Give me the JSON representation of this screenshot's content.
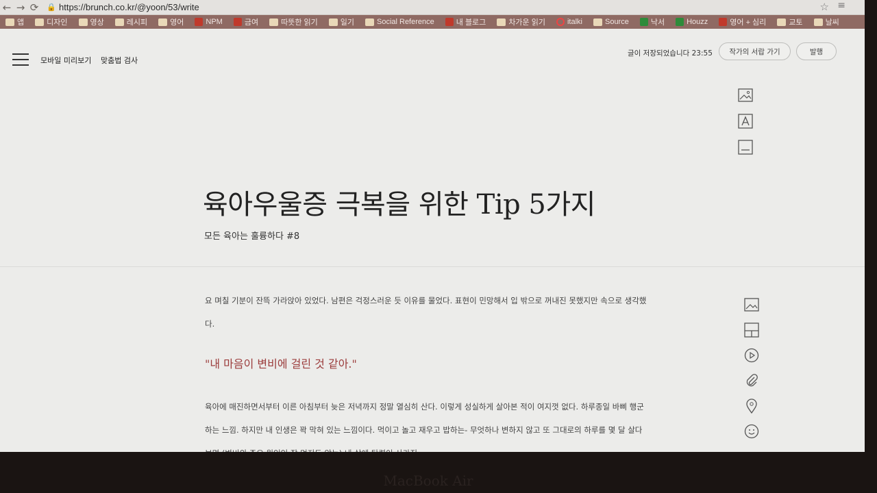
{
  "browser": {
    "url": "https://brunch.co.kr/@yoon/53/write",
    "bookmarks": [
      "앱",
      "디자인",
      "영상",
      "레시피",
      "영어",
      "NPM",
      "금여",
      "따뜻한 읽기",
      "일기",
      "Social Reference",
      "내 블로그",
      "차가운 읽기",
      "italki",
      "Source",
      "낙서",
      "Houzz",
      "영어 + 심리",
      "교토",
      "날씨"
    ]
  },
  "header": {
    "mobile_preview": "모바일 미리보기",
    "spell_check": "맞춤법 검사",
    "save_status": "글이 저장되었습니다 23:55",
    "drawer_button": "작가의 서랍 가기",
    "publish_button": "발행"
  },
  "post": {
    "title": "육아우울증 극복을 위한 Tip 5가지",
    "subtitle": "모든 육아는 훌륭하다 #8",
    "paragraph1": "요 며칠 기분이 잔뜩 가라앉아 있었다. 남편은 걱정스러운 듯 이유를 물었다. 표현이 민망해서 입 밖으로 꺼내진 못했지만 속으로 생각했다.",
    "quote": "\"내 마음이 변비에 걸린 것 같아.\"",
    "paragraph2": "육아에 매진하면서부터 이른 아침부터 늦은 저녁까지 정말 열심히 산다. 이렇게 성실하게 살아본 적이 여지껏 없다. 하루종일 바삐 행군하는 느낌. 하지만 내 인생은 꽉 막혀 있는 느낌이다. 먹이고 놀고 재우고 밥하는- 무엇하나 변하지 않고 또 그대로의 하루를 몇 달 살다 보면 (변비의 주요 원인인 잘 먹지도 않는) 내 삶에 탄력이 사라진"
  },
  "bezel": {
    "label": "MacBook Air"
  },
  "colors": {
    "accent_quote": "#9b3b3b",
    "bookmark_bar": "#8f6a63"
  }
}
